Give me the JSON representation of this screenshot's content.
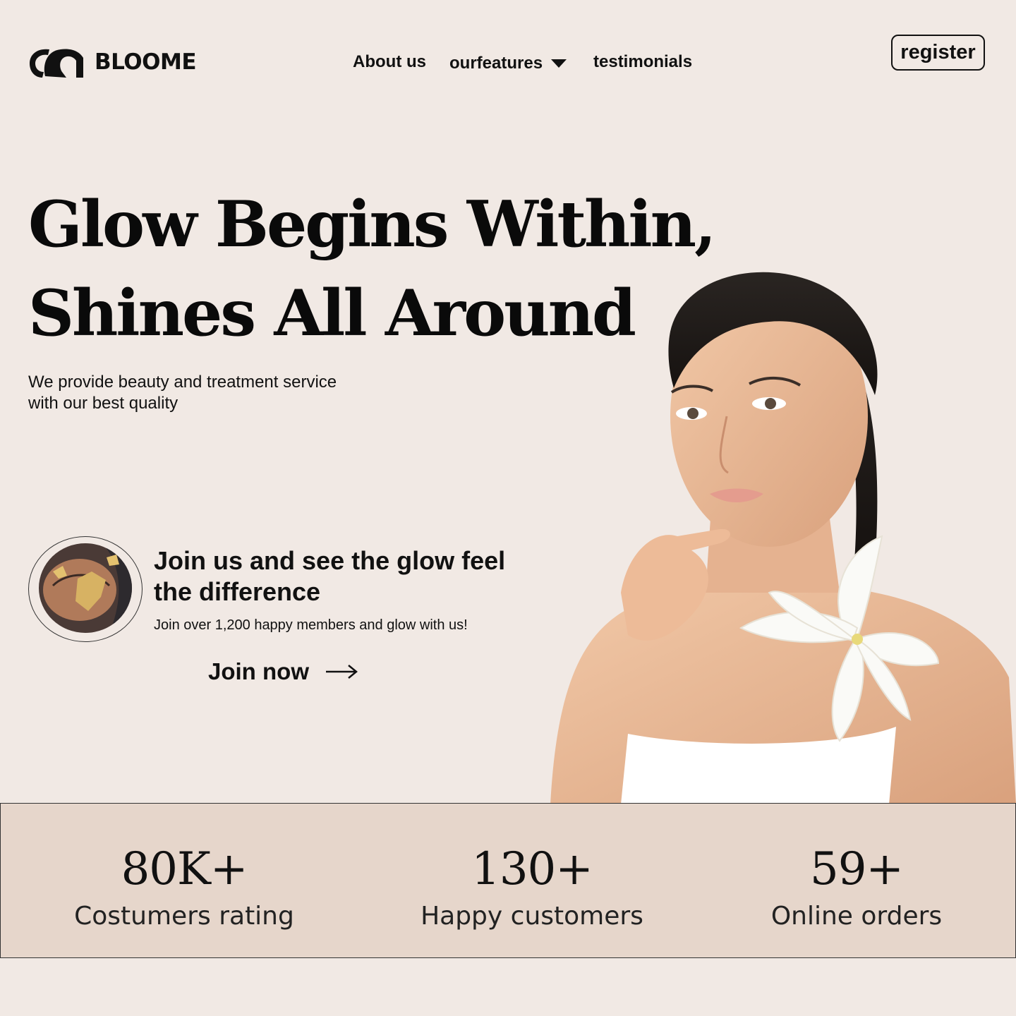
{
  "header": {
    "brand": "BLOOME",
    "nav": [
      {
        "label": "About us"
      },
      {
        "label": "ourfeatures",
        "icon": "chevron-down-icon"
      },
      {
        "label": "testimonials"
      }
    ],
    "register_label": "register"
  },
  "hero": {
    "title_line1": "Glow Begins Within,",
    "title_line2": "Shines All Around",
    "subtitle_line1": "We provide beauty and treatment service",
    "subtitle_line2": "with our best quality"
  },
  "join": {
    "title": "Join us and see the glow feel the difference",
    "subtitle": "Join over 1,200 happy members and glow with us!",
    "cta_label": "Join now",
    "cta_icon": "arrow-right-icon"
  },
  "stats": [
    {
      "value": "80K+",
      "label": "Costumers rating"
    },
    {
      "value": "130+",
      "label": "Happy customers"
    },
    {
      "value": "59+",
      "label": "Online orders"
    }
  ],
  "colors": {
    "background": "#F1E9E4",
    "stats_band": "#E6D6CB",
    "text": "#111111"
  }
}
